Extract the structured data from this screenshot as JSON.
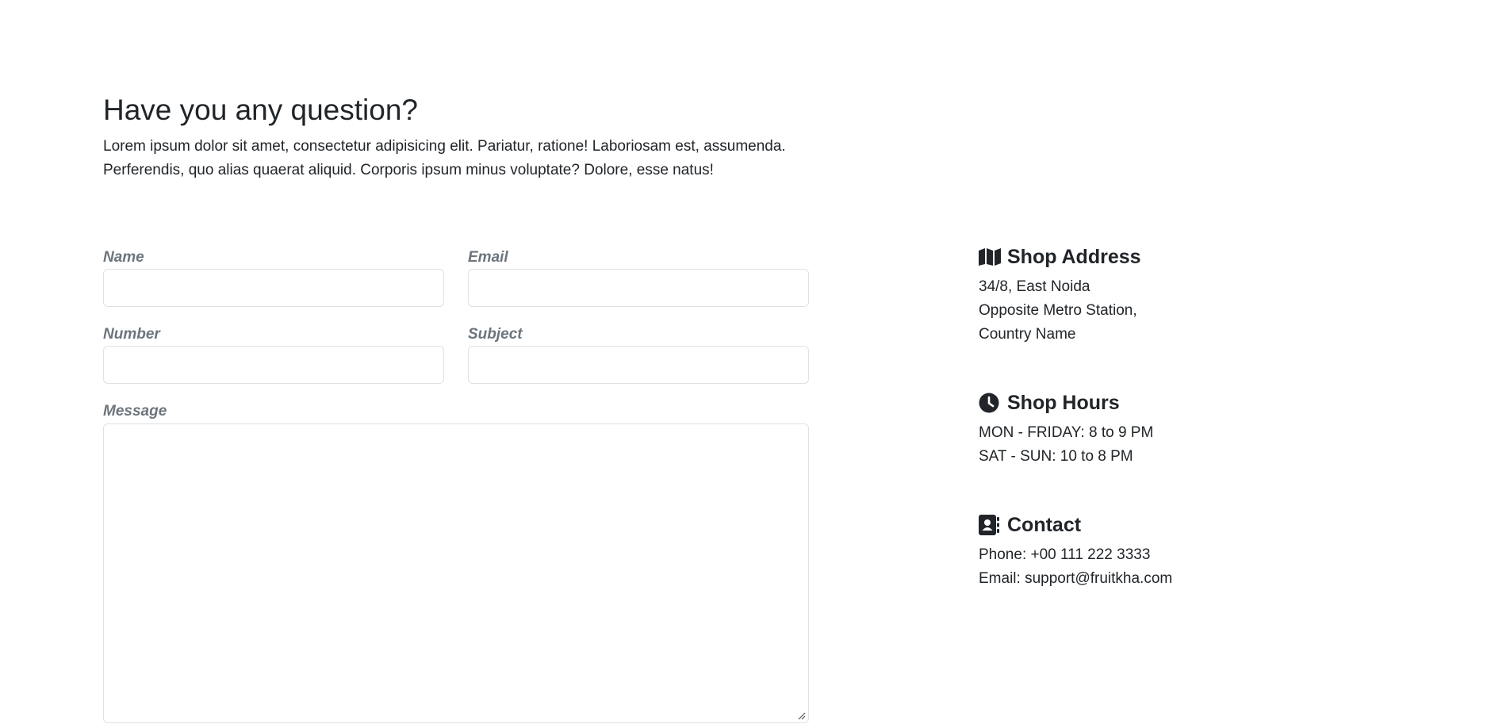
{
  "intro": {
    "title": "Have you any question?",
    "text": "Lorem ipsum dolor sit amet, consectetur adipisicing elit. Pariatur, ratione! Laboriosam est, assumenda. Perferendis, quo alias quaerat aliquid. Corporis ipsum minus voluptate? Dolore, esse natus!"
  },
  "form": {
    "name_label": "Name",
    "name_value": "",
    "email_label": "Email",
    "email_value": "",
    "number_label": "Number",
    "number_value": "",
    "subject_label": "Subject",
    "subject_value": "",
    "message_label": "Message",
    "message_value": ""
  },
  "info": {
    "address": {
      "icon": "map-icon",
      "heading": "Shop Address",
      "lines": [
        "34/8, East Noida",
        "Opposite Metro Station,",
        "Country Name"
      ]
    },
    "hours": {
      "icon": "clock-icon",
      "heading": "Shop Hours",
      "lines": [
        "MON - FRIDAY: 8 to 9 PM",
        "SAT - SUN: 10 to 8 PM"
      ]
    },
    "contact": {
      "icon": "address-book-icon",
      "heading": "Contact",
      "lines": [
        "Phone: +00 111 222 3333",
        "Email: support@fruitkha.com"
      ]
    }
  },
  "colors": {
    "text": "#212529",
    "label": "#6c757d",
    "border": "#dee2e6",
    "background": "#ffffff"
  }
}
